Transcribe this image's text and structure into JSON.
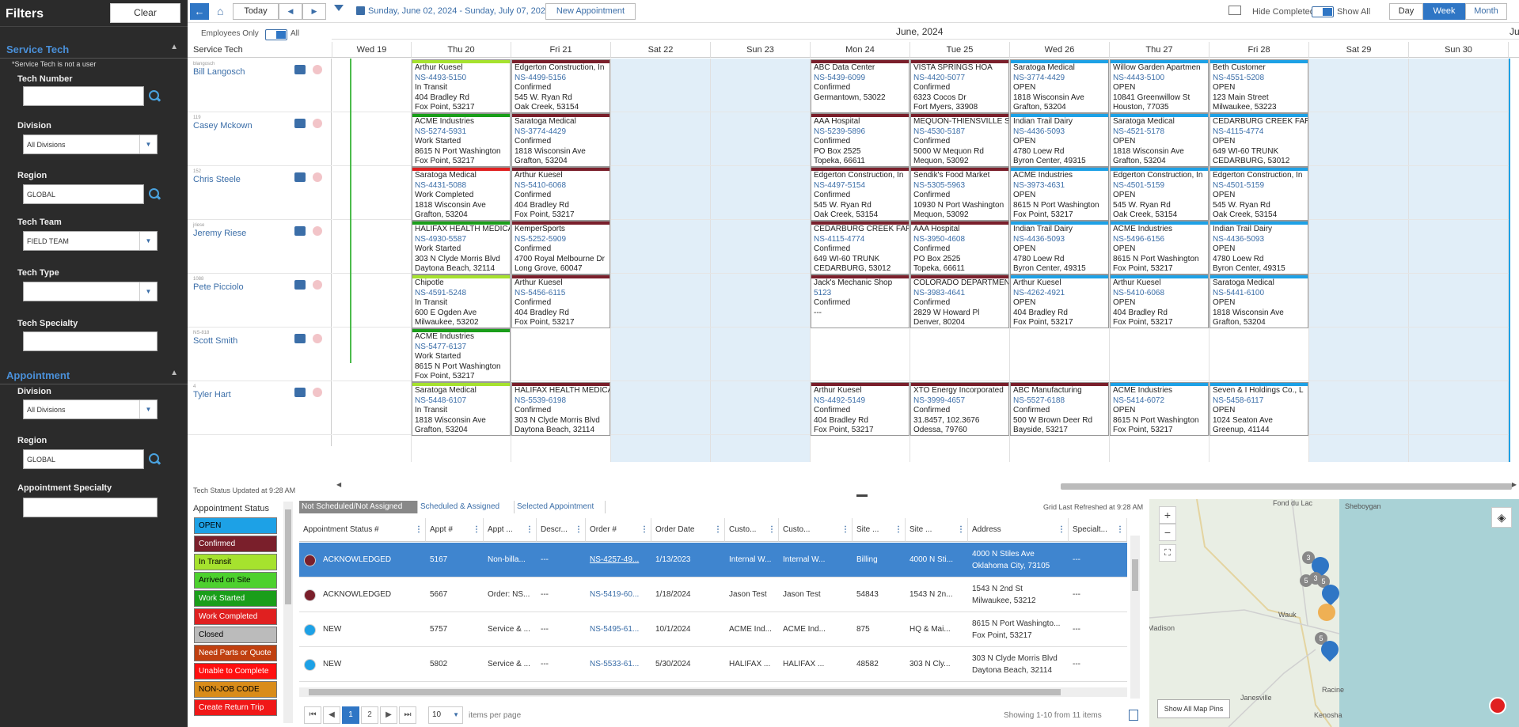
{
  "filters": {
    "title": "Filters",
    "clear": "Clear",
    "service_tech": {
      "header": "Service Tech",
      "note": "*Service Tech is not a user",
      "tech_number": "Tech Number",
      "division": "Division",
      "division_value": "All Divisions",
      "region": "Region",
      "region_value": "GLOBAL",
      "tech_team": "Tech Team",
      "tech_team_value": "FIELD TEAM",
      "tech_type": "Tech Type",
      "tech_specialty": "Tech Specialty"
    },
    "appointment": {
      "header": "Appointment",
      "division": "Division",
      "division_value": "All Divisions",
      "region": "Region",
      "region_value": "GLOBAL",
      "specialty": "Appointment Specialty"
    }
  },
  "toolbar": {
    "today": "Today",
    "date_range": "Sunday, June 02, 2024 - Sunday, July 07, 2024",
    "new_appt": "New Appointment",
    "hide_completed": "Hide Completed",
    "show_all": "Show All",
    "day": "Day",
    "week": "Week",
    "month": "Month"
  },
  "schedule": {
    "employees_only": "Employees Only",
    "all": "All",
    "month_label": "June, 2024",
    "month_label2": "Ju",
    "service_tech": "Service Tech",
    "tech_status": "Tech Status Updated at 9:28 AM",
    "days": [
      "Wed 19",
      "Thu 20",
      "Fri 21",
      "Sat 22",
      "Sun 23",
      "Mon 24",
      "Tue 25",
      "Wed 26",
      "Thu 27",
      "Fri 28",
      "Sat 29",
      "Sun 30"
    ],
    "techs": [
      {
        "num": "blangosch",
        "name": "Bill Langosch"
      },
      {
        "num": "119",
        "name": "Casey Mckown"
      },
      {
        "num": "152",
        "name": "Chris Steele"
      },
      {
        "num": "jriese",
        "name": "Jeremy Riese"
      },
      {
        "num": "1088",
        "name": "Pete Picciolo"
      },
      {
        "num": "NS-818",
        "name": "Scott Smith"
      },
      {
        "num": "4",
        "name": "Tyler Hart"
      }
    ],
    "cards": [
      {
        "row": 0,
        "day": 1,
        "color": "#a6e22e",
        "l1": "Arthur Kuesel",
        "l2": "NS-4493-5150",
        "l3": "In Transit",
        "l4": "404 Bradley Rd",
        "l5": "Fox Point, 53217"
      },
      {
        "row": 0,
        "day": 2,
        "color": "#7a1f2b",
        "l1": "Edgerton Construction, In",
        "l2": "NS-4499-5156",
        "l3": "Confirmed",
        "l4": "545 W. Ryan Rd",
        "l5": "Oak Creek, 53154"
      },
      {
        "row": 0,
        "day": 5,
        "color": "#7a1f2b",
        "l1": "ABC Data Center",
        "l2": "NS-5439-6099",
        "l3": "Confirmed",
        "l4": "",
        "l5": "Germantown, 53022"
      },
      {
        "row": 0,
        "day": 6,
        "color": "#7a1f2b",
        "l1": "VISTA SPRINGS HOA",
        "l2": "NS-4420-5077",
        "l3": "Confirmed",
        "l4": "6323 Cocos Dr",
        "l5": "Fort Myers, 33908"
      },
      {
        "row": 0,
        "day": 7,
        "color": "#1da1e6",
        "l1": "Saratoga Medical",
        "l2": "NS-3774-4429",
        "l3": "OPEN",
        "l4": "1818 Wisconsin Ave",
        "l5": "Grafton, 53204"
      },
      {
        "row": 0,
        "day": 8,
        "color": "#1da1e6",
        "l1": "Willow Garden Apartmen",
        "l2": "NS-4443-5100",
        "l3": "OPEN",
        "l4": "10841 Greenwillow St",
        "l5": "Houston, 77035"
      },
      {
        "row": 0,
        "day": 9,
        "color": "#1da1e6",
        "l1": "Beth Customer",
        "l2": "NS-4551-5208",
        "l3": "OPEN",
        "l4": "123 Main Street",
        "l5": "Milwaukee, 53223"
      },
      {
        "row": 1,
        "day": 1,
        "color": "#1a9e1a",
        "l1": "ACME Industries",
        "l2": "NS-5274-5931",
        "l3": "Work Started",
        "l4": "8615 N Port Washington",
        "l5": "Fox Point, 53217"
      },
      {
        "row": 1,
        "day": 2,
        "color": "#7a1f2b",
        "l1": "Saratoga Medical",
        "l2": "NS-3774-4429",
        "l3": "Confirmed",
        "l4": "1818 Wisconsin Ave",
        "l5": "Grafton, 53204"
      },
      {
        "row": 1,
        "day": 5,
        "color": "#7a1f2b",
        "l1": "AAA Hospital",
        "l2": "NS-5239-5896",
        "l3": "Confirmed",
        "l4": "PO Box 2525",
        "l5": "Topeka, 66611"
      },
      {
        "row": 1,
        "day": 6,
        "color": "#7a1f2b",
        "l1": "MEQUON-THIENSVILLE S",
        "l2": "NS-4530-5187",
        "l3": "Confirmed",
        "l4": "5000 W Mequon Rd",
        "l5": "Mequon, 53092"
      },
      {
        "row": 1,
        "day": 7,
        "color": "#1da1e6",
        "l1": "Indian Trail Dairy",
        "l2": "NS-4436-5093",
        "l3": "OPEN",
        "l4": "4780 Loew Rd",
        "l5": "Byron Center, 49315"
      },
      {
        "row": 1,
        "day": 8,
        "color": "#1da1e6",
        "l1": "Saratoga Medical",
        "l2": "NS-4521-5178",
        "l3": "OPEN",
        "l4": "1818 Wisconsin Ave",
        "l5": "Grafton, 53204"
      },
      {
        "row": 1,
        "day": 9,
        "color": "#1da1e6",
        "l1": "CEDARBURG CREEK FARM",
        "l2": "NS-4115-4774",
        "l3": "OPEN",
        "l4": "649 WI-60 TRUNK",
        "l5": "CEDARBURG, 53012"
      },
      {
        "row": 2,
        "day": 1,
        "color": "#e02020",
        "l1": "Saratoga Medical",
        "l2": "NS-4431-5088",
        "l3": "Work Completed",
        "l4": "1818 Wisconsin Ave",
        "l5": "Grafton, 53204"
      },
      {
        "row": 2,
        "day": 2,
        "color": "#7a1f2b",
        "l1": "Arthur Kuesel",
        "l2": "NS-5410-6068",
        "l3": "Confirmed",
        "l4": "404 Bradley Rd",
        "l5": "Fox Point, 53217"
      },
      {
        "row": 2,
        "day": 5,
        "color": "#7a1f2b",
        "l1": "Edgerton Construction, In",
        "l2": "NS-4497-5154",
        "l3": "Confirmed",
        "l4": "545 W. Ryan Rd",
        "l5": "Oak Creek, 53154"
      },
      {
        "row": 2,
        "day": 6,
        "color": "#7a1f2b",
        "l1": "Sendik's Food Market",
        "l2": "NS-5305-5963",
        "l3": "Confirmed",
        "l4": "10930 N Port Washington",
        "l5": "Mequon, 53092"
      },
      {
        "row": 2,
        "day": 7,
        "color": "#1da1e6",
        "l1": "ACME Industries",
        "l2": "NS-3973-4631",
        "l3": "OPEN",
        "l4": "8615 N Port Washington",
        "l5": "Fox Point, 53217"
      },
      {
        "row": 2,
        "day": 8,
        "color": "#1da1e6",
        "l1": "Edgerton Construction, In",
        "l2": "NS-4501-5159",
        "l3": "OPEN",
        "l4": "545 W. Ryan Rd",
        "l5": "Oak Creek, 53154"
      },
      {
        "row": 2,
        "day": 9,
        "color": "#1da1e6",
        "l1": "Edgerton Construction, In",
        "l2": "NS-4501-5159",
        "l3": "OPEN",
        "l4": "545 W. Ryan Rd",
        "l5": "Oak Creek, 53154"
      },
      {
        "row": 3,
        "day": 1,
        "color": "#1a9e1a",
        "l1": "HALIFAX HEALTH MEDICA",
        "l2": "NS-4930-5587",
        "l3": "Work Started",
        "l4": "303 N Clyde Morris Blvd",
        "l5": "Daytona Beach, 32114"
      },
      {
        "row": 3,
        "day": 2,
        "color": "#7a1f2b",
        "l1": "KemperSports",
        "l2": "NS-5252-5909",
        "l3": "Confirmed",
        "l4": "4700 Royal Melbourne Dr",
        "l5": "Long Grove, 60047"
      },
      {
        "row": 3,
        "day": 5,
        "color": "#7a1f2b",
        "l1": "CEDARBURG CREEK FARM",
        "l2": "NS-4115-4774",
        "l3": "Confirmed",
        "l4": "649 WI-60 TRUNK",
        "l5": "CEDARBURG, 53012"
      },
      {
        "row": 3,
        "day": 6,
        "color": "#7a1f2b",
        "l1": "AAA Hospital",
        "l2": "NS-3950-4608",
        "l3": "Confirmed",
        "l4": "PO Box 2525",
        "l5": "Topeka, 66611"
      },
      {
        "row": 3,
        "day": 7,
        "color": "#1da1e6",
        "l1": "Indian Trail Dairy",
        "l2": "NS-4436-5093",
        "l3": "OPEN",
        "l4": "4780 Loew Rd",
        "l5": "Byron Center, 49315"
      },
      {
        "row": 3,
        "day": 8,
        "color": "#1da1e6",
        "l1": "ACME Industries",
        "l2": "NS-5496-6156",
        "l3": "OPEN",
        "l4": "8615 N Port Washington",
        "l5": "Fox Point, 53217"
      },
      {
        "row": 3,
        "day": 9,
        "color": "#1da1e6",
        "l1": "Indian Trail Dairy",
        "l2": "NS-4436-5093",
        "l3": "OPEN",
        "l4": "4780 Loew Rd",
        "l5": "Byron Center, 49315"
      },
      {
        "row": 4,
        "day": 1,
        "color": "#a6e22e",
        "l1": "Chipotle",
        "l2": "NS-4591-5248",
        "l3": "In Transit",
        "l4": "600 E Ogden Ave",
        "l5": "Milwaukee, 53202"
      },
      {
        "row": 4,
        "day": 2,
        "color": "#7a1f2b",
        "l1": "Arthur Kuesel",
        "l2": "NS-5456-6115",
        "l3": "Confirmed",
        "l4": "404 Bradley Rd",
        "l5": "Fox Point, 53217"
      },
      {
        "row": 4,
        "day": 5,
        "color": "#7a1f2b",
        "l1": "Jack's Mechanic Shop",
        "l2": "5123",
        "l3": "Confirmed",
        "l4": "---",
        "l5": ""
      },
      {
        "row": 4,
        "day": 6,
        "color": "#7a1f2b",
        "l1": "COLORADO DEPARTMEN",
        "l2": "NS-3983-4641",
        "l3": "Confirmed",
        "l4": "2829 W Howard Pl",
        "l5": "Denver, 80204"
      },
      {
        "row": 4,
        "day": 7,
        "color": "#1da1e6",
        "l1": "Arthur Kuesel",
        "l2": "NS-4262-4921",
        "l3": "OPEN",
        "l4": "404 Bradley Rd",
        "l5": "Fox Point, 53217"
      },
      {
        "row": 4,
        "day": 8,
        "color": "#1da1e6",
        "l1": "Arthur Kuesel",
        "l2": "NS-5410-6068",
        "l3": "OPEN",
        "l4": "404 Bradley Rd",
        "l5": "Fox Point, 53217"
      },
      {
        "row": 4,
        "day": 9,
        "color": "#1da1e6",
        "l1": "Saratoga Medical",
        "l2": "NS-5441-6100",
        "l3": "OPEN",
        "l4": "1818 Wisconsin Ave",
        "l5": "Grafton, 53204"
      },
      {
        "row": 5,
        "day": 1,
        "color": "#1a9e1a",
        "l1": "ACME Industries",
        "l2": "NS-5477-6137",
        "l3": "Work Started",
        "l4": "8615 N Port Washington",
        "l5": "Fox Point, 53217"
      },
      {
        "row": 6,
        "day": 1,
        "color": "#a6e22e",
        "l1": "Saratoga Medical",
        "l2": "NS-5448-6107",
        "l3": "In Transit",
        "l4": "1818 Wisconsin Ave",
        "l5": "Grafton, 53204"
      },
      {
        "row": 6,
        "day": 2,
        "color": "#7a1f2b",
        "l1": "HALIFAX HEALTH MEDICA",
        "l2": "NS-5539-6198",
        "l3": "Confirmed",
        "l4": "303 N Clyde Morris Blvd",
        "l5": "Daytona Beach, 32114"
      },
      {
        "row": 6,
        "day": 5,
        "color": "#7a1f2b",
        "l1": "Arthur Kuesel",
        "l2": "NS-4492-5149",
        "l3": "Confirmed",
        "l4": "404 Bradley Rd",
        "l5": "Fox Point, 53217"
      },
      {
        "row": 6,
        "day": 6,
        "color": "#7a1f2b",
        "l1": "XTO Energy Incorporated",
        "l2": "NS-3999-4657",
        "l3": "Confirmed",
        "l4": "31.8457, 102.3676",
        "l5": "Odessa, 79760"
      },
      {
        "row": 6,
        "day": 7,
        "color": "#7a1f2b",
        "l1": "ABC Manufacturing",
        "l2": "NS-5527-6188",
        "l3": "Confirmed",
        "l4": "500 W Brown Deer Rd",
        "l5": "Bayside, 53217"
      },
      {
        "row": 6,
        "day": 8,
        "color": "#1da1e6",
        "l1": "ACME Industries",
        "l2": "NS-5414-6072",
        "l3": "OPEN",
        "l4": "8615 N Port Washington",
        "l5": "Fox Point, 53217"
      },
      {
        "row": 6,
        "day": 9,
        "color": "#1da1e6",
        "l1": "Seven & I Holdings Co., L",
        "l2": "NS-5458-6117",
        "l3": "OPEN",
        "l4": "1024 Seaton Ave",
        "l5": "Greenup, 41144"
      }
    ]
  },
  "legend": {
    "title": "Appointment Status",
    "items": [
      {
        "label": "OPEN",
        "color": "#1da1e6",
        "fg": "#000"
      },
      {
        "label": "Confirmed",
        "color": "#7a1f2b",
        "fg": "#fff"
      },
      {
        "label": "In Transit",
        "color": "#a6e22e",
        "fg": "#000"
      },
      {
        "label": "Arrived on Site",
        "color": "#4dd12e",
        "fg": "#000"
      },
      {
        "label": "Work Started",
        "color": "#1a9e1a",
        "fg": "#fff"
      },
      {
        "label": "Work Completed",
        "color": "#e02020",
        "fg": "#fff"
      },
      {
        "label": "Closed",
        "color": "#bbbbbb",
        "fg": "#000"
      },
      {
        "label": "Need Parts or Quote",
        "color": "#c04010",
        "fg": "#fff"
      },
      {
        "label": "Unable to Complete",
        "color": "#ff1010",
        "fg": "#fff"
      },
      {
        "label": "NON-JOB CODE",
        "color": "#d98c1a",
        "fg": "#000"
      },
      {
        "label": "Create Return Trip",
        "color": "#f01818",
        "fg": "#fff"
      }
    ]
  },
  "table": {
    "tabs": [
      "Not Scheduled/Not Assigned",
      "Scheduled & Assigned",
      "Selected Appointment"
    ],
    "grid_refreshed": "Grid Last Refreshed at 9:28 AM",
    "headers": [
      "Appointment Status #",
      "Appt #",
      "Appt ...",
      "Descr...",
      "Order #",
      "Order Date",
      "Custo...",
      "Custo...",
      "Site ...",
      "Site ...",
      "Address",
      "Specialt..."
    ],
    "rows": [
      {
        "dot": "#7a1f2b",
        "status": "ACKNOWLEDGED",
        "appt": "5167",
        "type": "Non-billa...",
        "descr": "---",
        "order": "NS-4257-49...",
        "date": "1/13/2023",
        "cust1": "Internal W...",
        "cust2": "Internal W...",
        "site1": "Billing",
        "site2": "4000 N Sti...",
        "addr1": "4000 N Stiles Ave",
        "addr2": "Oklahoma City, 73105",
        "spec": "---"
      },
      {
        "dot": "#7a1f2b",
        "status": "ACKNOWLEDGED",
        "appt": "5667",
        "type": "Order: NS...",
        "descr": "---",
        "order": "NS-5419-60...",
        "date": "1/18/2024",
        "cust1": "Jason Test",
        "cust2": "Jason Test",
        "site1": "54843",
        "site2": "1543 N 2n...",
        "addr1": "1543 N 2nd St",
        "addr2": "Milwaukee, 53212",
        "spec": "---"
      },
      {
        "dot": "#1da1e6",
        "status": "NEW",
        "appt": "5757",
        "type": "Service & ...",
        "descr": "---",
        "order": "NS-5495-61...",
        "date": "10/1/2024",
        "cust1": "ACME Ind...",
        "cust2": "ACME Ind...",
        "site1": "875",
        "site2": "HQ & Mai...",
        "addr1": "8615 N Port Washingto...",
        "addr2": "Fox Point, 53217",
        "spec": "---"
      },
      {
        "dot": "#1da1e6",
        "status": "NEW",
        "appt": "5802",
        "type": "Service & ...",
        "descr": "---",
        "order": "NS-5533-61...",
        "date": "5/30/2024",
        "cust1": "HALIFAX ...",
        "cust2": "HALIFAX ...",
        "site1": "48582",
        "site2": "303 N Cly...",
        "addr1": "303 N Clyde Morris Blvd",
        "addr2": "Daytona Beach, 32114",
        "spec": "---"
      }
    ],
    "pager": {
      "p1": "1",
      "p2": "2",
      "per_page": "10",
      "per_label": "items per page",
      "showing": "Showing 1-10 from 11 items"
    }
  },
  "map": {
    "labels": {
      "fdl": "Fond du Lac",
      "sheb": "Sheboygan",
      "madison": "Madison",
      "wauk": "Wauk",
      "janes": "Janesville",
      "racine": "Racine",
      "kenosha": "Kenosha"
    },
    "show_pins": "Show All Map Pins",
    "clusters": [
      "3",
      "5",
      "3",
      "5",
      "5"
    ]
  }
}
